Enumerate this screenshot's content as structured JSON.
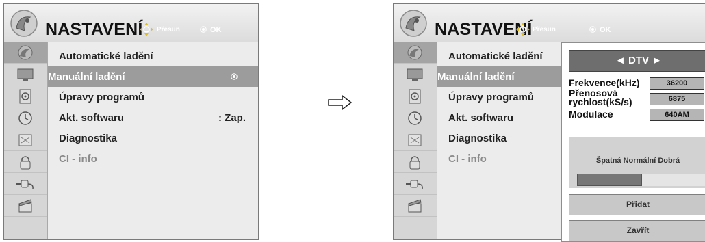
{
  "colors": {
    "panel_bg": "#ececec",
    "sidebar_bg": "#d6d6d6",
    "highlight": "#9c9c9c",
    "popup_bar": "#6e6e6e"
  },
  "left": {
    "header": {
      "title": "NASTAVENÍ",
      "move_label": "Přesun",
      "ok_label": "OK"
    },
    "sidebar_icons": [
      "satellite-dish-icon",
      "tv-screen-icon",
      "speaker-icon",
      "clock-icon",
      "picture-frame-icon",
      "padlock-icon",
      "plug-icon",
      "film-clapper-icon"
    ],
    "menu": [
      {
        "label": "Automatické ladění",
        "value": "",
        "state": "normal"
      },
      {
        "label": "Manuální ladění",
        "value": "",
        "state": "active"
      },
      {
        "label": "Úpravy programů",
        "value": "",
        "state": "normal"
      },
      {
        "label": "Akt. softwaru",
        "value": ": Zap.",
        "state": "normal"
      },
      {
        "label": "Diagnostika",
        "value": "",
        "state": "normal"
      },
      {
        "label": "CI - info",
        "value": "",
        "state": "disabled"
      }
    ]
  },
  "right": {
    "header": {
      "title": "NASTAVENÍ",
      "move_label": "Přesun",
      "ok_label": "OK"
    },
    "menu": [
      {
        "label": "Automatické ladění",
        "state": "normal"
      },
      {
        "label": "Manuální ladění",
        "state": "active"
      },
      {
        "label": "Úpravy programů",
        "state": "normal"
      },
      {
        "label": "Akt. softwaru",
        "state": "normal"
      },
      {
        "label": "Diagnostika",
        "state": "normal"
      },
      {
        "label": "CI - info",
        "state": "disabled"
      }
    ],
    "popup": {
      "mode_label": "◄ DTV ►",
      "fields": [
        {
          "label": "Frekvence(kHz)",
          "value": "36200"
        },
        {
          "label": "Přenosová rychlost(kS/s)",
          "value": "6875"
        },
        {
          "label": "Modulace",
          "value": "640AM"
        }
      ],
      "signal_label": "Špatná Normální Dobrá",
      "signal_level_fraction": 0.5,
      "add_button": "Přidat",
      "close_button": "Zavřít"
    }
  }
}
